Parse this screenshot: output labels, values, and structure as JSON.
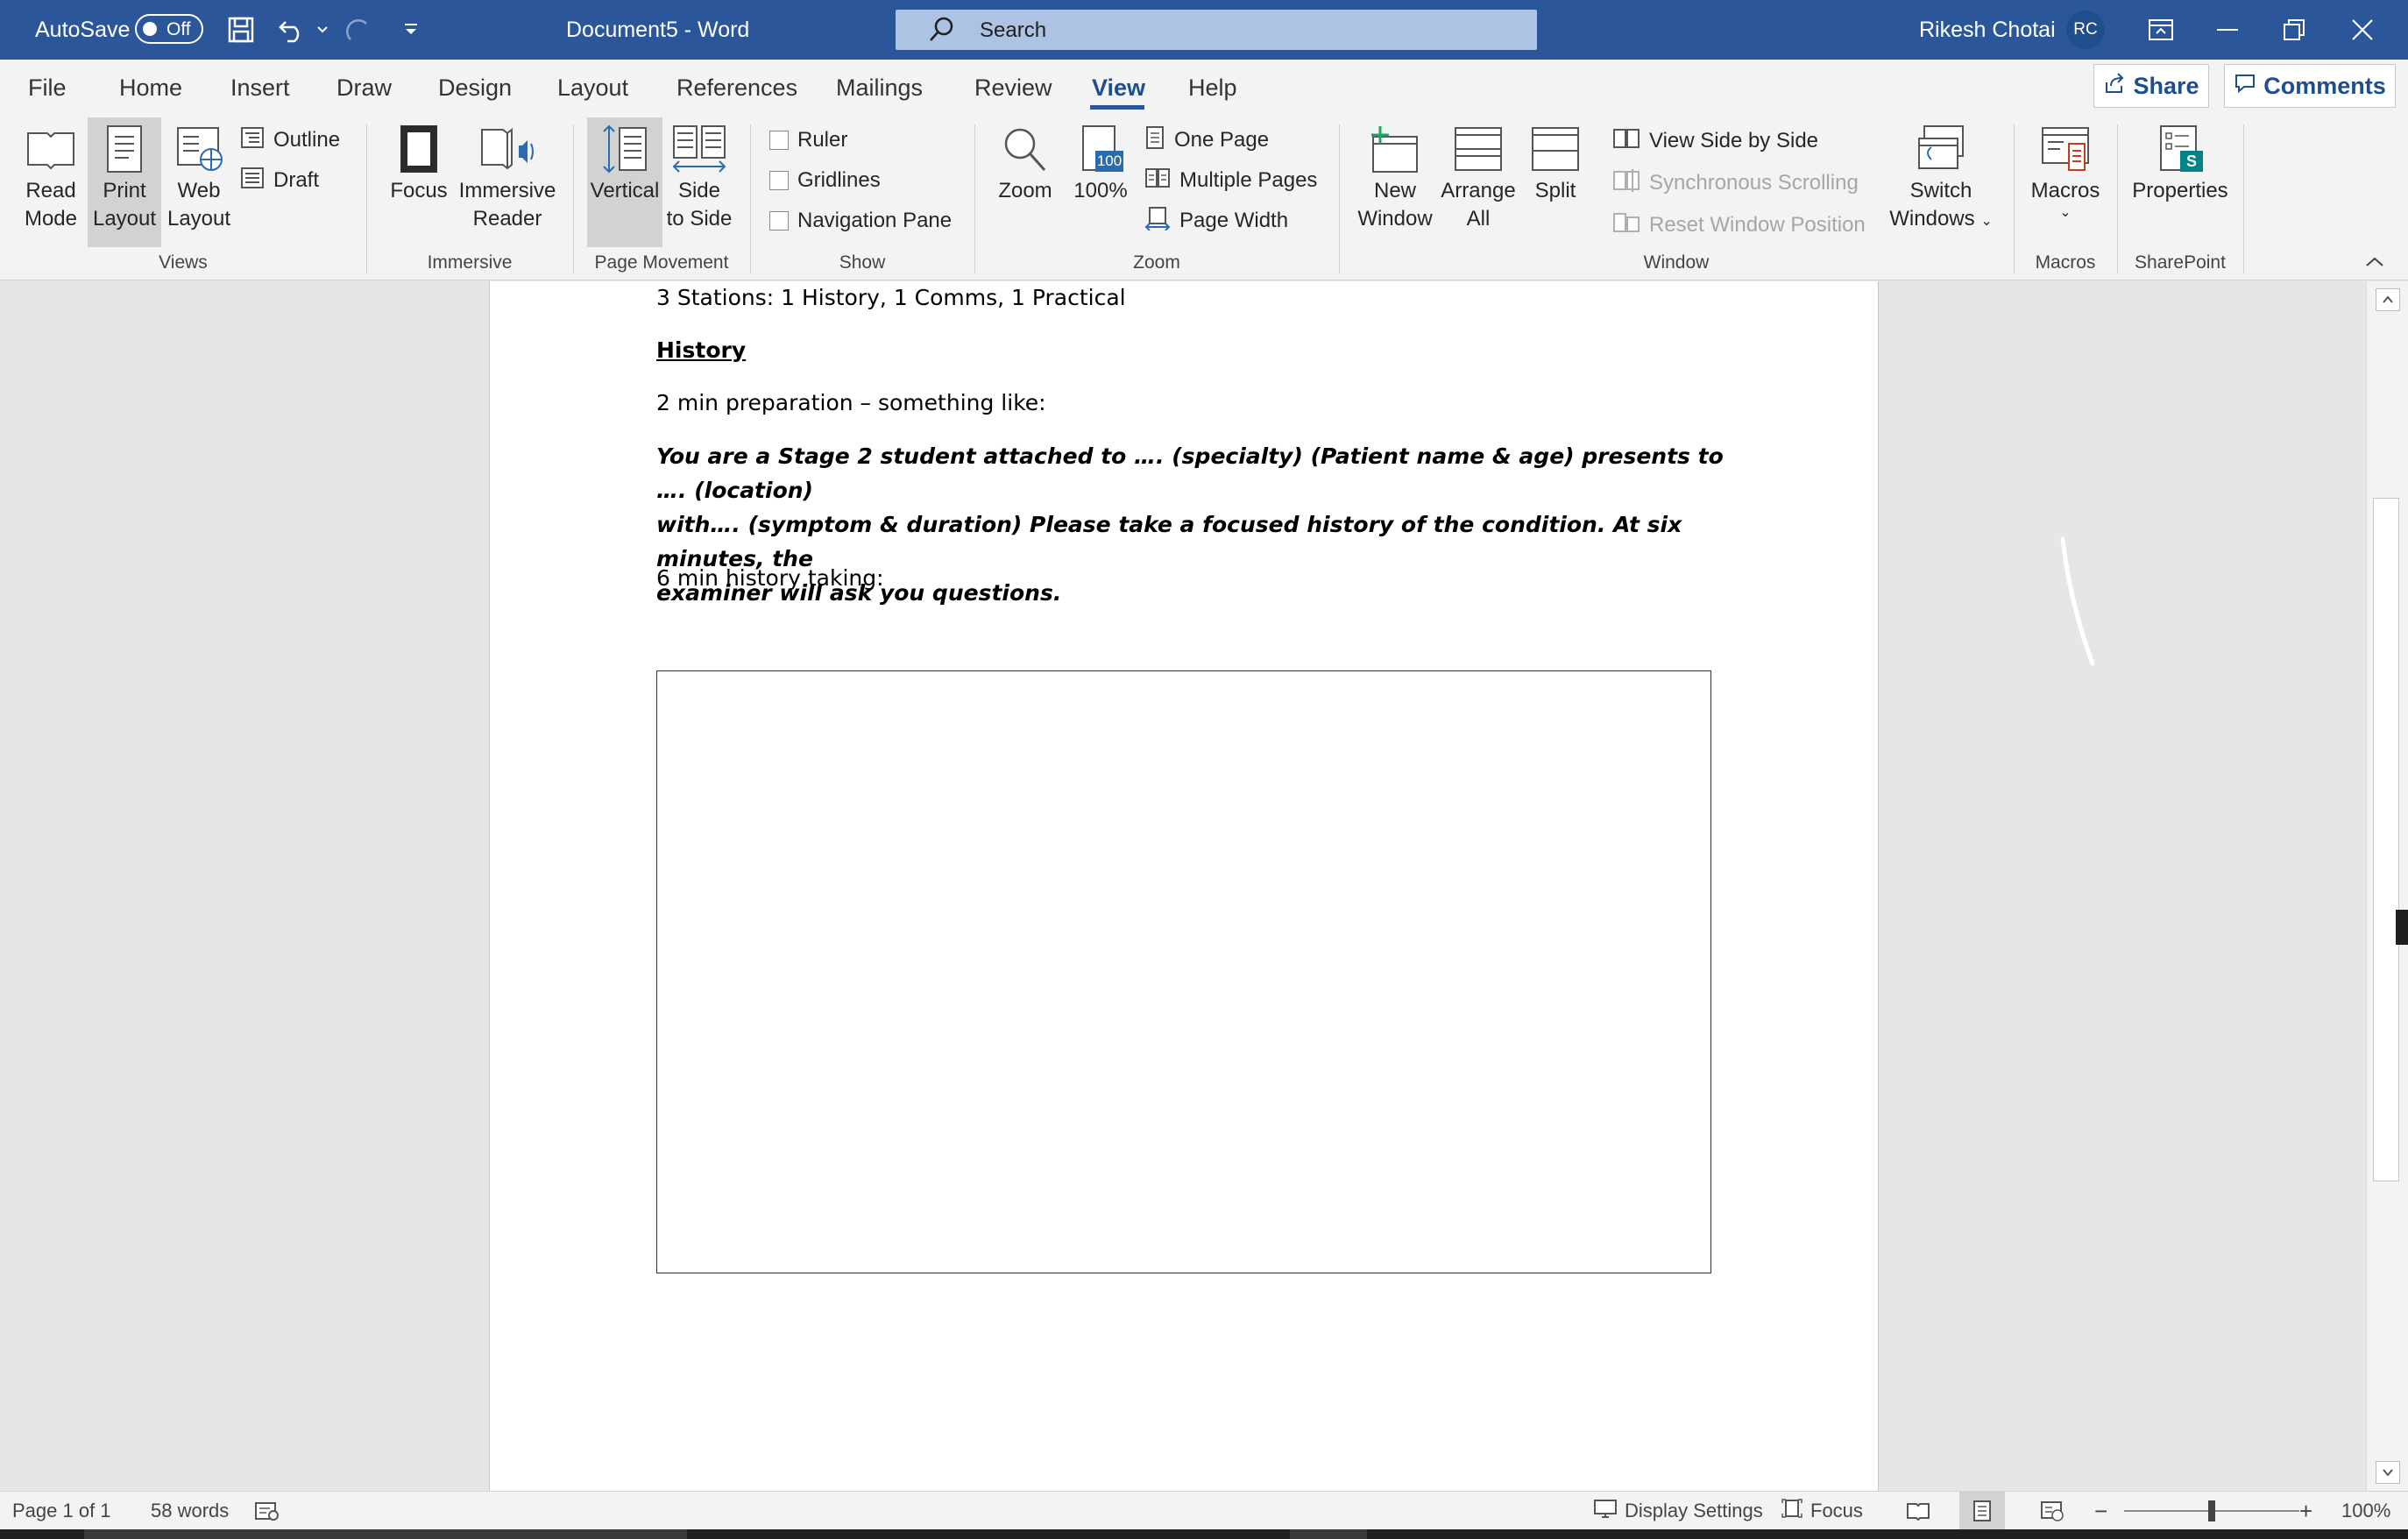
{
  "titlebar": {
    "autosave_label": "AutoSave",
    "autosave_state": "Off",
    "document_title": "Document5  -  Word",
    "search_placeholder": "Search",
    "user_name": "Rikesh Chotai",
    "user_initials": "RC"
  },
  "tabs": [
    "File",
    "Home",
    "Insert",
    "Draw",
    "Design",
    "Layout",
    "References",
    "Mailings",
    "Review",
    "View",
    "Help"
  ],
  "active_tab": "View",
  "share_label": "Share",
  "comments_label": "Comments",
  "ribbon": {
    "views": {
      "read_mode": [
        "Read",
        "Mode"
      ],
      "print_layout": [
        "Print",
        "Layout"
      ],
      "web_layout": [
        "Web",
        "Layout"
      ],
      "outline": "Outline",
      "draft": "Draft",
      "group_label": "Views"
    },
    "immersive": {
      "focus": "Focus",
      "immersive_reader": [
        "Immersive",
        "Reader"
      ],
      "group_label": "Immersive"
    },
    "page_movement": {
      "vertical": "Vertical",
      "side_to_side": [
        "Side",
        "to Side"
      ],
      "group_label": "Page Movement"
    },
    "show": {
      "ruler": "Ruler",
      "gridlines": "Gridlines",
      "navigation_pane": "Navigation Pane",
      "group_label": "Show"
    },
    "zoom": {
      "zoom": "Zoom",
      "hundred_icon_text": "100",
      "hundred": "100%",
      "one_page": "One Page",
      "multiple_pages": "Multiple Pages",
      "page_width": "Page Width",
      "group_label": "Zoom"
    },
    "window": {
      "new_window": [
        "New",
        "Window"
      ],
      "arrange_all": [
        "Arrange",
        "All"
      ],
      "split": "Split",
      "view_side_by_side": "View Side by Side",
      "synchronous_scrolling": "Synchronous Scrolling",
      "reset_window_position": "Reset Window Position",
      "switch_windows": [
        "Switch",
        "Windows"
      ],
      "group_label": "Window"
    },
    "macros": {
      "macros": "Macros",
      "group_label": "Macros"
    },
    "sharepoint": {
      "properties": "Properties",
      "badge": "S",
      "group_label": "SharePoint"
    }
  },
  "document": {
    "line1": "3 Stations: 1 History, 1 Comms, 1 Practical",
    "heading": "History",
    "line2": "2 min preparation – something like:",
    "prompt_lines": [
      "You are a Stage 2 student attached to …. (specialty) (Patient name & age) presents to …. (location)",
      "with…. (symptom & duration) Please take a focused history of the condition. At six minutes, the",
      "examiner will ask you questions."
    ],
    "line3": "6 min history taking:"
  },
  "statusbar": {
    "page": "Page 1 of 1",
    "words": "58 words",
    "display_settings": "Display Settings",
    "focus": "Focus",
    "zoom_level": "100%",
    "zoom_fraction": 0.5
  },
  "colors": {
    "title_bar": "#2b579a",
    "accent": "#1e4e8c",
    "ribbon_bg": "#f3f3f3",
    "canvas_bg": "#e6e6e6"
  },
  "icons": [
    "save-icon",
    "undo-icon",
    "redo-icon",
    "customize-qat-icon",
    "search-icon",
    "ribbon-display-icon",
    "minimize-icon",
    "restore-icon",
    "close-icon",
    "share-icon",
    "comments-icon",
    "collapse-ribbon-icon",
    "proofing-icon"
  ]
}
